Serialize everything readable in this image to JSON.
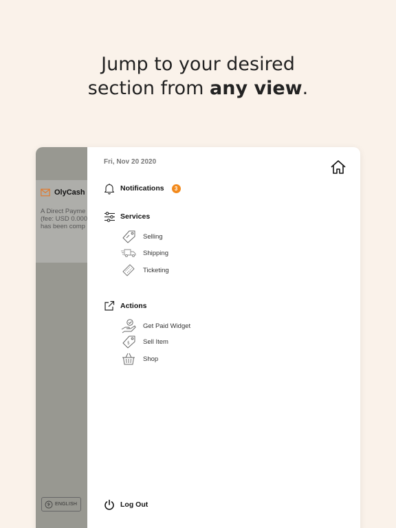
{
  "headline": {
    "line1": "Jump to your desired",
    "line2_prefix": "section from ",
    "line2_bold": "any view",
    "line2_suffix": "."
  },
  "background_notification": {
    "title": "OlyCash",
    "body_lines": [
      "A Direct Payme",
      "(fee: USD 0.000",
      "has been comp"
    ]
  },
  "language_button": {
    "label": "ENGLISH"
  },
  "menu": {
    "date": "Fri, Nov 20 2020",
    "notifications": {
      "label": "Notifications",
      "count": "3"
    },
    "services": {
      "label": "Services",
      "items": [
        {
          "label": "Selling",
          "icon": "tag-icon"
        },
        {
          "label": "Shipping",
          "icon": "delivery-truck-icon"
        },
        {
          "label": "Ticketing",
          "icon": "ticket-icon"
        }
      ]
    },
    "actions": {
      "label": "Actions",
      "items": [
        {
          "label": "Get Paid Widget",
          "icon": "hand-check-icon"
        },
        {
          "label": "Sell Item",
          "icon": "price-tag-icon"
        },
        {
          "label": "Shop",
          "icon": "basket-icon"
        }
      ]
    },
    "logout": {
      "label": "Log Out"
    }
  },
  "colors": {
    "page_bg": "#faf2ea",
    "badge": "#f28a1d",
    "mail_icon": "#e07a2e",
    "overlay": "#989891"
  }
}
